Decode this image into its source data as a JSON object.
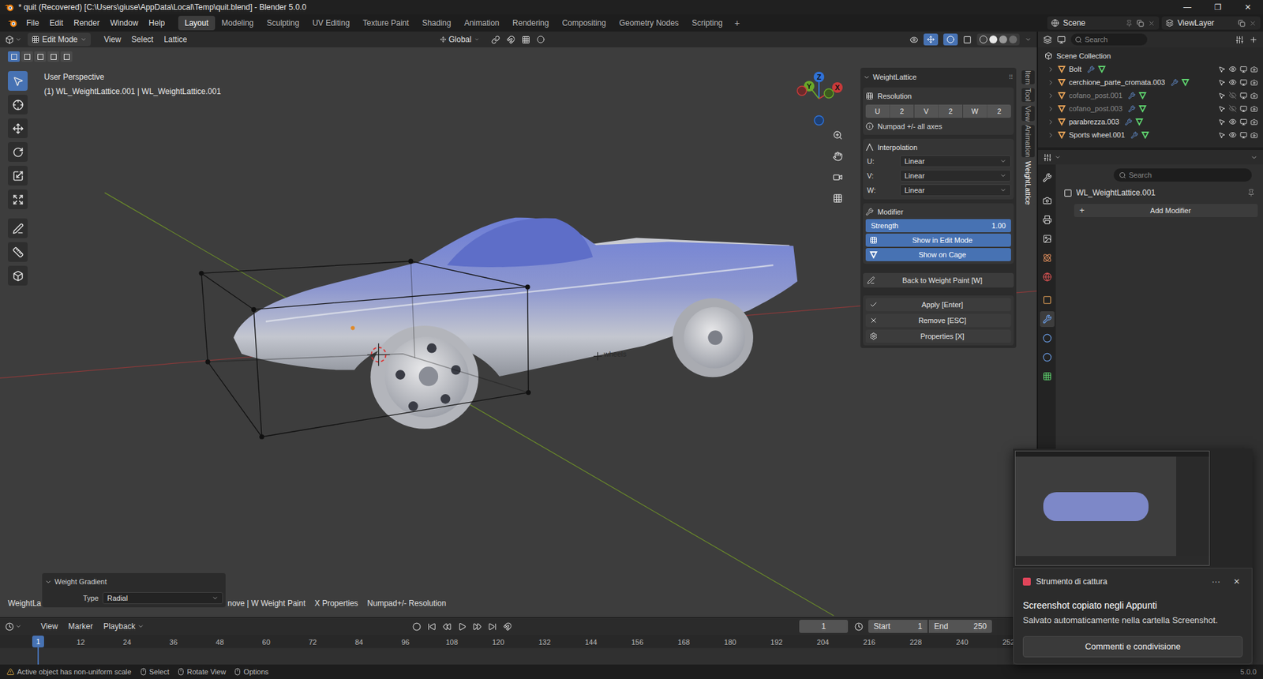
{
  "window": {
    "title": "* quit (Recovered) [C:\\Users\\giuse\\AppData\\Local\\Temp\\quit.blend] - Blender 5.0.0",
    "controls": [
      "—",
      "❐",
      "✕"
    ]
  },
  "menus": [
    "File",
    "Edit",
    "Render",
    "Window",
    "Help"
  ],
  "workspaces": [
    {
      "label": "Layout",
      "selected": true
    },
    {
      "label": "Modeling",
      "selected": false
    },
    {
      "label": "Sculpting",
      "selected": false
    },
    {
      "label": "UV Editing",
      "selected": false
    },
    {
      "label": "Texture Paint",
      "selected": false
    },
    {
      "label": "Shading",
      "selected": false
    },
    {
      "label": "Animation",
      "selected": false
    },
    {
      "label": "Rendering",
      "selected": false
    },
    {
      "label": "Compositing",
      "selected": false
    },
    {
      "label": "Geometry Nodes",
      "selected": false
    },
    {
      "label": "Scripting",
      "selected": false
    }
  ],
  "add_workspace": "+",
  "scene": "Scene",
  "view_layer": "ViewLayer",
  "viewport_header": {
    "mode": "Edit Mode",
    "menus": [
      "View",
      "Select",
      "Lattice"
    ],
    "orientation": "Global"
  },
  "viewport": {
    "view_name": "User Perspective",
    "object_info": "(1) WL_WeightLattice.001 | WL_WeightLattice.001",
    "empty_label": "wheels",
    "axes": {
      "x": "X",
      "y": "Y",
      "z": "Z"
    }
  },
  "side_tabs": [
    {
      "label": "Item",
      "selected": false
    },
    {
      "label": "Tool",
      "selected": false
    },
    {
      "label": "View",
      "selected": false
    },
    {
      "label": "Animation",
      "selected": false
    },
    {
      "label": "WeightLattice",
      "selected": true
    }
  ],
  "n_panel": {
    "title": "WeightLattice",
    "resolution": {
      "title": "Resolution",
      "axes": [
        {
          "label": "U",
          "value": "2"
        },
        {
          "label": "V",
          "value": "2"
        },
        {
          "label": "W",
          "value": "2"
        }
      ],
      "hint": "Numpad +/- all axes"
    },
    "interpolation": {
      "title": "Interpolation",
      "axes": [
        {
          "label": "U:",
          "value": "Linear"
        },
        {
          "label": "V:",
          "value": "Linear"
        },
        {
          "label": "W:",
          "value": "Linear"
        }
      ]
    },
    "modifier": {
      "title": "Modifier",
      "strength": {
        "label": "Strength",
        "reading": "1.00",
        "level": 1
      },
      "toggles": [
        {
          "label": "Show in Edit Mode",
          "on": true
        },
        {
          "label": "Show on Cage",
          "on": true
        }
      ]
    },
    "back": "Back to Weight Paint [W]",
    "actions": [
      "Apply [Enter]",
      "Remove [ESC]",
      "Properties [X]"
    ]
  },
  "operator_panel": {
    "title": "Weight Gradient",
    "label": "Type",
    "value": "Radial"
  },
  "hints": {
    "left": "WeightLa",
    "right": [
      "nove | W Weight Paint",
      "X Properties",
      "Numpad+/- Resolution"
    ]
  },
  "outliner": {
    "search": "Search",
    "root": "Scene Collection",
    "items": [
      {
        "name": "Bolt",
        "hidden": false
      },
      {
        "name": "cerchione_parte_cromata.003",
        "hidden": false
      },
      {
        "name": "cofano_post.001",
        "hidden": true
      },
      {
        "name": "cofano_post.003",
        "hidden": true
      },
      {
        "name": "parabrezza.003",
        "hidden": false
      },
      {
        "name": "Sports wheel.001",
        "hidden": false
      }
    ]
  },
  "properties": {
    "search": "Search",
    "object": "WL_WeightLattice.001",
    "add_icon": "+",
    "add_modifier": "Add Modifier",
    "tabs": [
      {
        "selected": false
      },
      {
        "selected": false
      },
      {
        "selected": false
      },
      {
        "selected": false
      },
      {
        "selected": false
      },
      {
        "selected": false
      },
      {
        "selected": false
      },
      {
        "selected": true
      },
      {
        "selected": false
      },
      {
        "selected": false
      },
      {
        "selected": false
      }
    ]
  },
  "timeline": {
    "menus": [
      "View",
      "Marker",
      "Playback"
    ],
    "current_frame": "1",
    "start_label": "Start",
    "start": "1",
    "end_label": "End",
    "end": "250",
    "ruler": [
      "12",
      "24",
      "36",
      "48",
      "60",
      "72",
      "84",
      "96",
      "108",
      "120",
      "132",
      "144",
      "156",
      "168",
      "180",
      "192",
      "204",
      "216",
      "228",
      "240",
      "252"
    ]
  },
  "status_bar": {
    "warning": "Active object has non-uniform scale",
    "hints": [
      "Select",
      "Rotate View",
      "Options"
    ],
    "version": "5.0.0"
  },
  "notification": {
    "app": "Strumento di cattura",
    "more": "···",
    "close": "✕",
    "title": "Screenshot copiato negli Appunti",
    "body": "Salvato automaticamente nella cartella Screenshot.",
    "button": "Commenti e condivisione"
  }
}
